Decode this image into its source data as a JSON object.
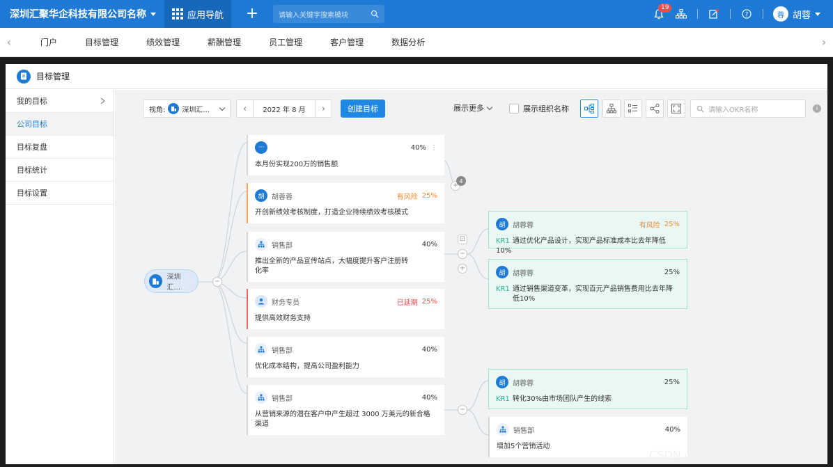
{
  "topbar": {
    "company": "深圳汇聚华企科技有限公司名称",
    "app_nav": "应用导航",
    "search_placeholder": "请输入关键字搜索模块",
    "notification_count": "19",
    "user_avatar": "蓉",
    "user_name": "胡蓉"
  },
  "menu": {
    "items": [
      "门户",
      "目标管理",
      "绩效管理",
      "薪酬管理",
      "员工管理",
      "客户管理",
      "数据分析"
    ]
  },
  "page": {
    "title": "目标管理"
  },
  "sidebar": {
    "items": [
      "我的目标",
      "公司目标",
      "目标复盘",
      "目标统计",
      "目标设置"
    ]
  },
  "toolbar": {
    "view_label": "视角:",
    "view_value": "深圳汇...",
    "month": "2022 年 8 月",
    "create_button": "创建目标",
    "show_more": "展示更多",
    "show_org_name": "展示组织名称",
    "okr_search_placeholder": "请输入OKR名称"
  },
  "tree": {
    "root_label": "深圳汇...",
    "collapsed_count": "4",
    "objectives": [
      {
        "owner": "",
        "status": "",
        "progress": "40%",
        "title": "本月份实现200万的销售额"
      },
      {
        "owner": "胡蓉蓉",
        "avatar": "胡",
        "status": "有风险",
        "progress": "25%",
        "title": "开创新绩效考核制度，打造企业持续绩效考核模式"
      },
      {
        "owner": "销售部",
        "status": "",
        "progress": "40%",
        "title_line1": "推出全新的产品宣传站点，大幅度提升客户注册转",
        "title_line2": "化率"
      },
      {
        "owner": "财务专员",
        "status": "已延期",
        "progress": "25%",
        "title": "提供高效财务支持"
      },
      {
        "owner": "销售部",
        "status": "",
        "progress": "40%",
        "title": "优化成本结构，提高公司盈利能力"
      },
      {
        "owner": "销售部",
        "status": "",
        "progress": "40%",
        "title_line1": "从营销来源的潜在客户中产生超过 3000 万美元的新合格",
        "title_line2": "渠道"
      }
    ],
    "key_results": [
      {
        "owner": "胡蓉蓉",
        "avatar": "胡",
        "status": "有风险",
        "progress": "25%",
        "tag": "KR1",
        "text": "通过优化产品设计，实现产品标准成本比去年降低10%"
      },
      {
        "owner": "胡蓉蓉",
        "avatar": "胡",
        "status": "",
        "progress": "25%",
        "tag": "KR1",
        "text_line1": "通过销售渠道变革，实现百元产品销售费用比去年降",
        "text_line2": "低10%"
      },
      {
        "owner": "胡蓉蓉",
        "avatar": "胡",
        "status": "",
        "progress": "25%",
        "tag": "KR1",
        "text": "转化30%由市场团队产生的线索"
      }
    ],
    "sub_objective": {
      "owner": "销售部",
      "progress": "40%",
      "title": "增加5个营销活动"
    }
  },
  "watermark": "CSDN @Teamface~企典软件"
}
